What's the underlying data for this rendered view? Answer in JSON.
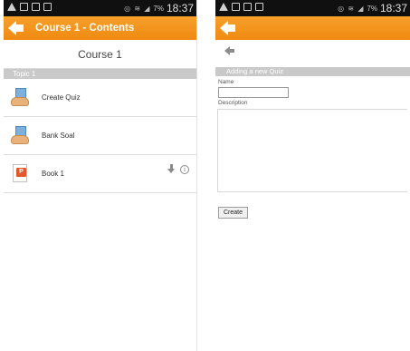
{
  "status_bar": {
    "time": "18:37",
    "battery": "7%"
  },
  "left_screen": {
    "title": "Course 1 - Contents",
    "course_name": "Course 1",
    "topic": "Topic 1",
    "modules": [
      {
        "label": "Create Quiz",
        "icon": "quiz-module-icon"
      },
      {
        "label": "Bank Soal",
        "icon": "quiz-module-icon"
      },
      {
        "label": "Book 1",
        "icon": "book-ppt-icon",
        "badge": "P"
      }
    ]
  },
  "right_screen": {
    "section_title": "Adding a new Quiz",
    "name_label": "Name",
    "name_value": "",
    "description_label": "Description",
    "description_value": "",
    "create_label": "Create"
  },
  "colors": {
    "accent": "#f39a1e",
    "status_bar": "#101010",
    "topic_bar": "#c9c9c9"
  }
}
